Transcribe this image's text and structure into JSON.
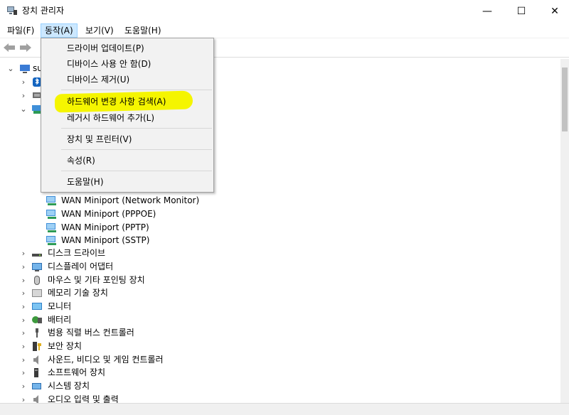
{
  "window": {
    "title": "장치 관리자",
    "minimize": "—",
    "maximize": "☐",
    "close": "✕"
  },
  "menubar": [
    {
      "label": "파일(F)"
    },
    {
      "label": "동작(A)"
    },
    {
      "label": "보기(V)"
    },
    {
      "label": "도움말(H)"
    }
  ],
  "action_menu": {
    "items": [
      "드라이버 업데이트(P)",
      "디바이스 사용 안 함(D)",
      "디바이스 제거(U)",
      "하드웨어 변경 사항 검색(A)",
      "레거시 하드웨어 추가(L)",
      "장치 및 프린터(V)",
      "속성(R)",
      "도움말(H)"
    ],
    "highlighted_item": "하드웨어 변경 사항 검색(A)",
    "highlight_color": "#f5f500"
  },
  "tree": {
    "root_prefix": "su",
    "network_children": [
      "WAN Miniport (Network Monitor)",
      "WAN Miniport (PPPOE)",
      "WAN Miniport (PPTP)",
      "WAN Miniport (SSTP)"
    ],
    "categories": [
      "디스크 드라이브",
      "디스플레이 어댑터",
      "마우스 및 기타 포인팅 장치",
      "메모리 기술 장치",
      "모니터",
      "배터리",
      "범용 직렬 버스 컨트롤러",
      "보안 장치",
      "사운드, 비디오 및 게임 컨트롤러",
      "소프트웨어 장치",
      "시스템 장치",
      "오디오 입력 및 출력"
    ]
  }
}
